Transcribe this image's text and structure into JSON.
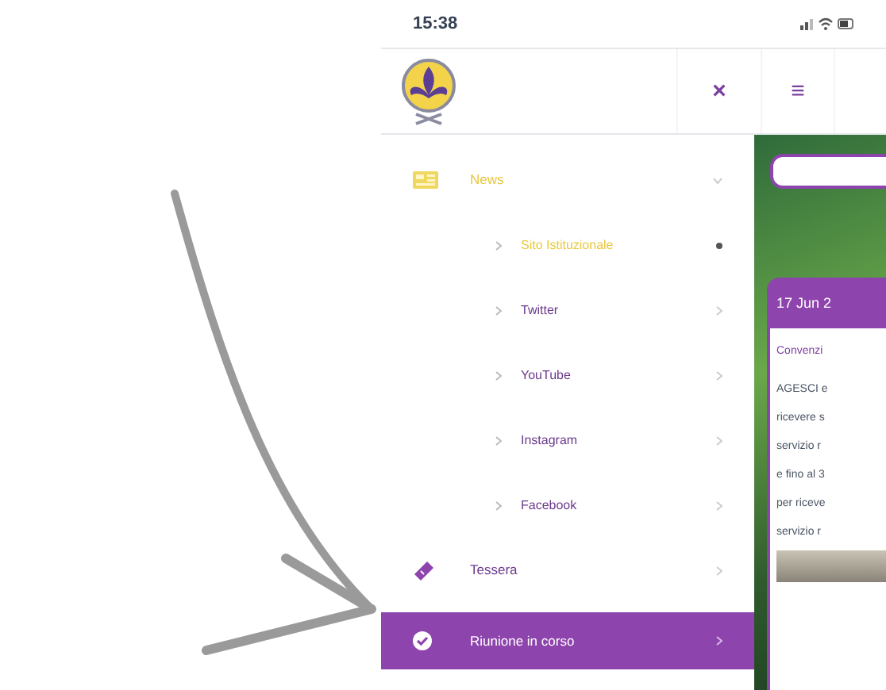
{
  "status_bar": {
    "time": "15:38"
  },
  "header": {
    "close_glyph": "×",
    "menu_glyph": "≡"
  },
  "menu": [
    {
      "kind": "section",
      "label": "News",
      "selected": true,
      "expanded": true
    },
    {
      "kind": "sub",
      "label": "Sito Istituzionale",
      "selected": true
    },
    {
      "kind": "sub",
      "label": "Twitter",
      "selected": false
    },
    {
      "kind": "sub",
      "label": "YouTube",
      "selected": false
    },
    {
      "kind": "sub",
      "label": "Instagram",
      "selected": false
    },
    {
      "kind": "sub",
      "label": "Facebook",
      "selected": false
    },
    {
      "kind": "section",
      "label": "Tessera",
      "selected": false,
      "expanded": false
    },
    {
      "kind": "active",
      "label": "Riunione in corso",
      "selected": true,
      "expanded": false
    }
  ],
  "card": {
    "date": "17 Jun 2",
    "title": "Convenzi",
    "lines": [
      "AGESCI e",
      "ricevere s",
      "servizio r",
      "e fino al 3",
      "per riceve",
      "servizio r"
    ]
  }
}
